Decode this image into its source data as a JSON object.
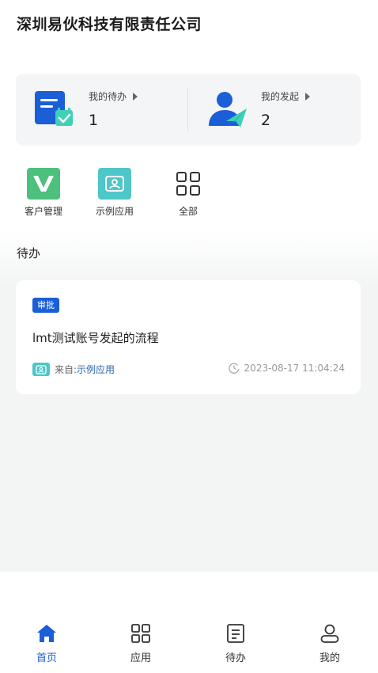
{
  "header": {
    "company": "深圳易伙科技有限责任公司"
  },
  "summary": {
    "todo": {
      "label": "我的待办",
      "count": "1",
      "icon": "todo-doc-icon"
    },
    "initiated": {
      "label": "我的发起",
      "count": "2",
      "icon": "user-send-icon"
    }
  },
  "apps": [
    {
      "label": "客户管理",
      "icon": "v-logo-icon",
      "color": "#4cc07c"
    },
    {
      "label": "示例应用",
      "icon": "person-card-icon",
      "color": "#4fc6c8"
    },
    {
      "label": "全部",
      "icon": "grid-icon"
    }
  ],
  "section": {
    "title": "待办"
  },
  "task": {
    "badge": "审批",
    "title": "lmt测试账号发起的流程",
    "source_prefix": "来自:",
    "source_app": "示例应用",
    "time": "2023-08-17 11:04:24"
  },
  "tabs": [
    {
      "label": "首页",
      "icon": "home-icon",
      "active": true
    },
    {
      "label": "应用",
      "icon": "apps-grid-icon",
      "active": false
    },
    {
      "label": "待办",
      "icon": "document-icon",
      "active": false
    },
    {
      "label": "我的",
      "icon": "user-icon",
      "active": false
    }
  ],
  "colors": {
    "accent": "#1a5ed8",
    "card_bg": "#f4f5f6"
  }
}
